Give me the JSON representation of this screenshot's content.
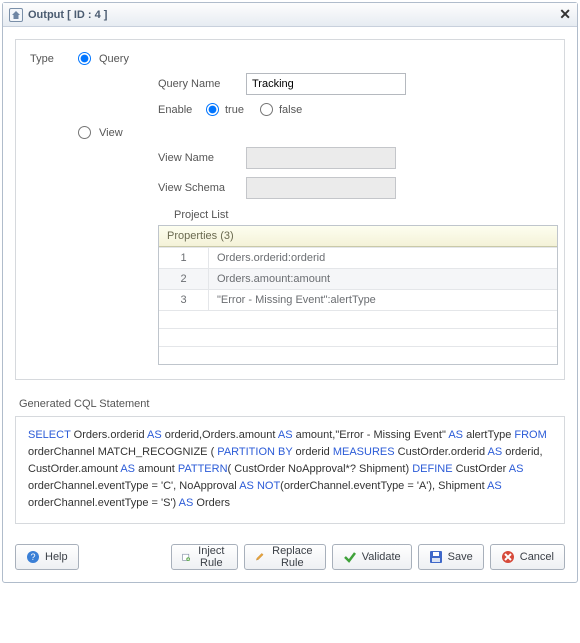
{
  "header": {
    "title": "Output [ ID : 4 ]"
  },
  "form": {
    "type_label": "Type",
    "query_radio": "Query",
    "view_radio": "View",
    "query_name_label": "Query Name",
    "query_name_value": "Tracking",
    "enable_label": "Enable",
    "enable_true": "true",
    "enable_false": "false",
    "view_name_label": "View Name",
    "view_name_value": "",
    "view_schema_label": "View Schema",
    "view_schema_value": "",
    "project_list_label": "Project List"
  },
  "properties": {
    "header": "Properties (3)",
    "rows": [
      {
        "idx": "1",
        "val": "Orders.orderid:orderid"
      },
      {
        "idx": "2",
        "val": "Orders.amount:amount"
      },
      {
        "idx": "3",
        "val": "\"Error - Missing Event\":alertType"
      }
    ]
  },
  "cql_label": "Generated CQL Statement",
  "cql": {
    "t1": "SELECT",
    "t2": " Orders.orderid ",
    "t3": "AS",
    "t4": " orderid,Orders.amount ",
    "t5": "AS",
    "t6": " amount,\"Error - Missing Event\" ",
    "t7": "AS",
    "t8": " alertType ",
    "t9": "FROM",
    "t10": " orderChannel  MATCH_RECOGNIZE ( ",
    "t11": "PARTITION BY",
    "t12": " orderid ",
    "t13": "MEASURES",
    "t14": " CustOrder.orderid ",
    "t15": "AS",
    "t16": " orderid, CustOrder.amount ",
    "t17": "AS",
    "t18": " amount ",
    "t19": "PATTERN",
    "t20": "( CustOrder NoApproval*? Shipment) ",
    "t21": "DEFINE",
    "t22": " CustOrder ",
    "t23": "AS",
    "t24": " orderChannel.eventType = 'C', NoApproval ",
    "t25": "AS",
    "t26": " ",
    "t27": "NOT",
    "t28": "(orderChannel.eventType = 'A'), Shipment ",
    "t29": "AS",
    "t30": " orderChannel.eventType = 'S') ",
    "t31": "AS",
    "t32": " Orders"
  },
  "buttons": {
    "help": "Help",
    "inject": "Inject Rule",
    "replace": "Replace Rule",
    "validate": "Validate",
    "save": "Save",
    "cancel": "Cancel"
  }
}
